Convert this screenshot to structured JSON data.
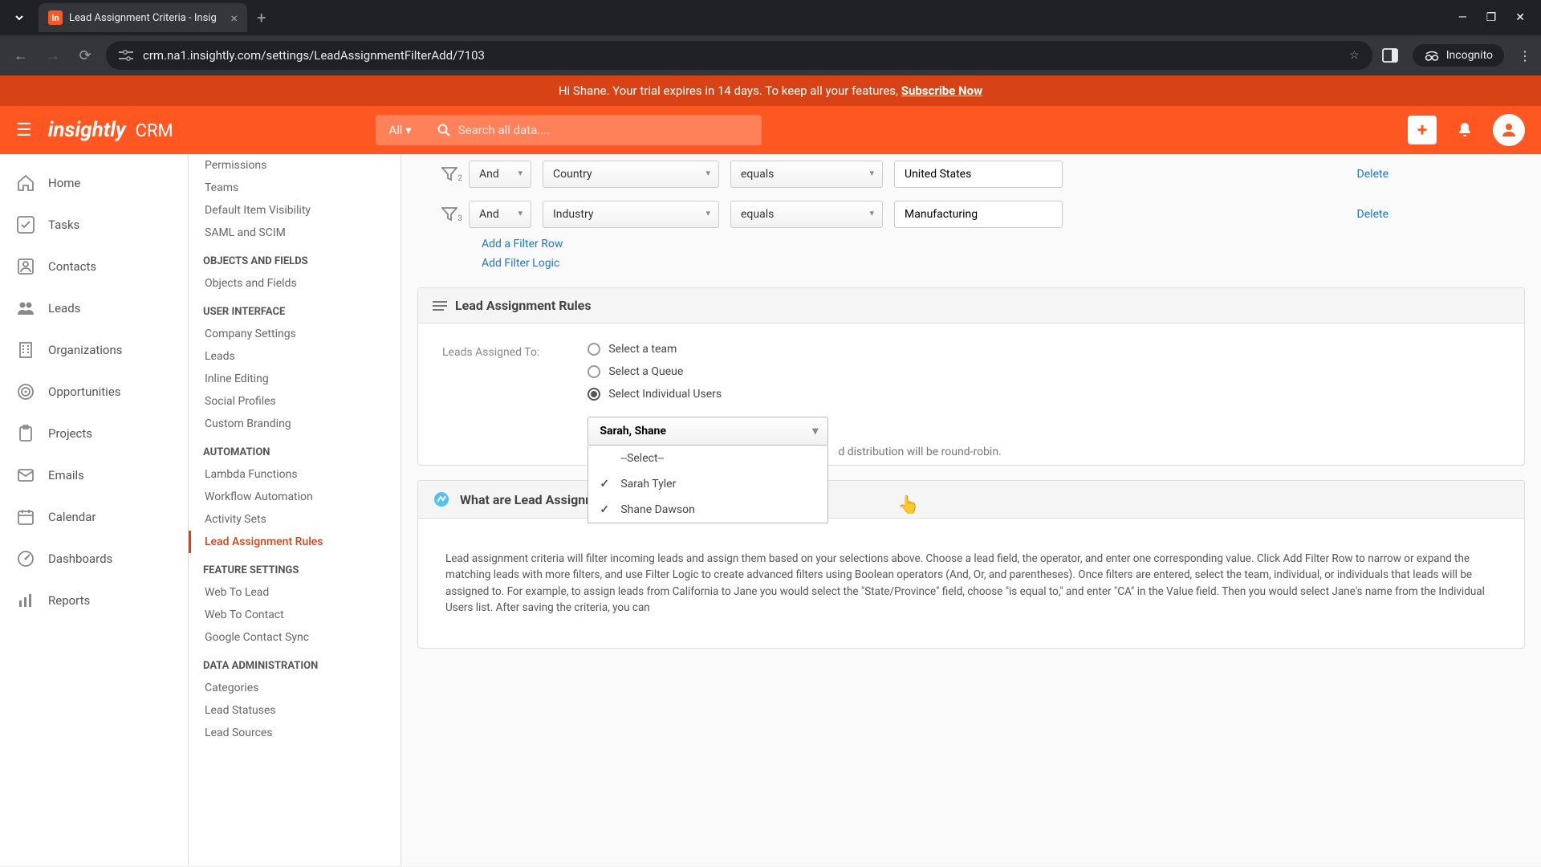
{
  "browser": {
    "tab_title": "Lead Assignment Criteria - Insig",
    "url": "crm.na1.insightly.com/settings/LeadAssignmentFilterAdd/7103",
    "incognito_label": "Incognito"
  },
  "trial_banner": {
    "greeting": "Hi Shane. Your trial expires in 14 days. To keep all your features, ",
    "cta": "Subscribe Now"
  },
  "header": {
    "logo": "insightly",
    "product": "CRM",
    "search_scope": "All",
    "search_placeholder": "Search all data...."
  },
  "left_nav": [
    {
      "label": "Home",
      "icon": "home"
    },
    {
      "label": "Tasks",
      "icon": "check"
    },
    {
      "label": "Contacts",
      "icon": "contact"
    },
    {
      "label": "Leads",
      "icon": "people"
    },
    {
      "label": "Organizations",
      "icon": "building"
    },
    {
      "label": "Opportunities",
      "icon": "target"
    },
    {
      "label": "Projects",
      "icon": "clipboard"
    },
    {
      "label": "Emails",
      "icon": "mail"
    },
    {
      "label": "Calendar",
      "icon": "calendar"
    },
    {
      "label": "Dashboards",
      "icon": "gauge"
    },
    {
      "label": "Reports",
      "icon": "bars"
    }
  ],
  "settings_sidebar": {
    "groups": [
      {
        "header": "",
        "items": [
          "Permissions",
          "Teams",
          "Default Item Visibility",
          "SAML and SCIM"
        ]
      },
      {
        "header": "OBJECTS AND FIELDS",
        "items": [
          "Objects and Fields"
        ]
      },
      {
        "header": "USER INTERFACE",
        "items": [
          "Company Settings",
          "Leads",
          "Inline Editing",
          "Social Profiles",
          "Custom Branding"
        ]
      },
      {
        "header": "AUTOMATION",
        "items": [
          "Lambda Functions",
          "Workflow Automation",
          "Activity Sets",
          "Lead Assignment Rules"
        ]
      },
      {
        "header": "FEATURE SETTINGS",
        "items": [
          "Web To Lead",
          "Web To Contact",
          "Google Contact Sync"
        ]
      },
      {
        "header": "DATA ADMINISTRATION",
        "items": [
          "Categories",
          "Lead Statuses",
          "Lead Sources"
        ]
      }
    ],
    "active": "Lead Assignment Rules"
  },
  "filters": {
    "rows": [
      {
        "idx": "2",
        "logic": "And",
        "field": "Country",
        "op": "equals",
        "value": "United States"
      },
      {
        "idx": "3",
        "logic": "And",
        "field": "Industry",
        "op": "equals",
        "value": "Manufacturing"
      }
    ],
    "delete_label": "Delete",
    "add_row": "Add a Filter Row",
    "add_logic": "Add Filter Logic"
  },
  "rules_panel": {
    "title": "Lead Assignment Rules",
    "assigned_label": "Leads Assigned To:",
    "options": {
      "team": "Select a team",
      "queue": "Select a Queue",
      "users": "Select Individual Users"
    },
    "user_select_display": "Sarah, Shane",
    "dropdown": {
      "placeholder": "--Select--",
      "items": [
        {
          "label": "Sarah Tyler",
          "checked": true
        },
        {
          "label": "Shane Dawson",
          "checked": true
        }
      ]
    },
    "hint_tail": "d distribution will be round-robin."
  },
  "info_panel": {
    "title": "What are Lead Assignment Criteria?",
    "body": "Lead assignment criteria will filter incoming leads and assign them based on your selections above. Choose a lead field, the operator, and enter one corresponding value. Click Add Filter Row to narrow or expand the matching leads with more filters, and use Filter Logic to create advanced filters using Boolean operators (And, Or, and parentheses). Once filters are entered, select the team, individual, or individuals that leads will be assigned to. For example, to assign leads from California to Jane you would select the \"State/Province\" field, choose \"is equal to,\" and enter \"CA\" in the Value field. Then you would select Jane's name from the Individual Users list. After saving the criteria, you can"
  }
}
